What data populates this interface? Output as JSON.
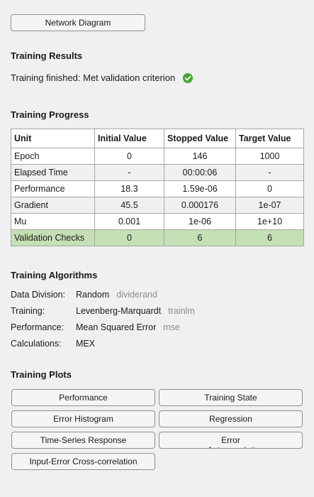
{
  "network_button": "Network Diagram",
  "results": {
    "title": "Training Results",
    "status": "Training finished: Met validation criterion",
    "status_icon": "check-circle-icon",
    "status_color": "#44a832"
  },
  "progress": {
    "title": "Training Progress",
    "headers": [
      "Unit",
      "Initial Value",
      "Stopped Value",
      "Target Value"
    ],
    "rows": [
      [
        "Epoch",
        "0",
        "146",
        "1000"
      ],
      [
        "Elapsed Time",
        "-",
        "00:00:06",
        "-"
      ],
      [
        "Performance",
        "18.3",
        "1.59e-06",
        "0"
      ],
      [
        "Gradient",
        "45.5",
        "0.000176",
        "1e-07"
      ],
      [
        "Mu",
        "0.001",
        "1e-06",
        "1e+10"
      ],
      [
        "Validation Checks",
        "0",
        "6",
        "6"
      ]
    ],
    "highlight_color": "#c5e0b4"
  },
  "algorithms": {
    "title": "Training Algorithms",
    "items": [
      {
        "label": "Data Division:",
        "value": "Random",
        "fn": "dividerand"
      },
      {
        "label": "Training:",
        "value": "Levenberg-Marquardt",
        "fn": "trainlm"
      },
      {
        "label": "Performance:",
        "value": "Mean Squared Error",
        "fn": "mse"
      },
      {
        "label": "Calculations:",
        "value": "MEX",
        "fn": ""
      }
    ]
  },
  "plots": {
    "title": "Training Plots",
    "buttons": [
      "Performance",
      "Training State",
      "Error Histogram",
      "Regression",
      "Time-Series Response",
      "Error Autocorrelation",
      "Input-Error Cross-correlation"
    ]
  }
}
